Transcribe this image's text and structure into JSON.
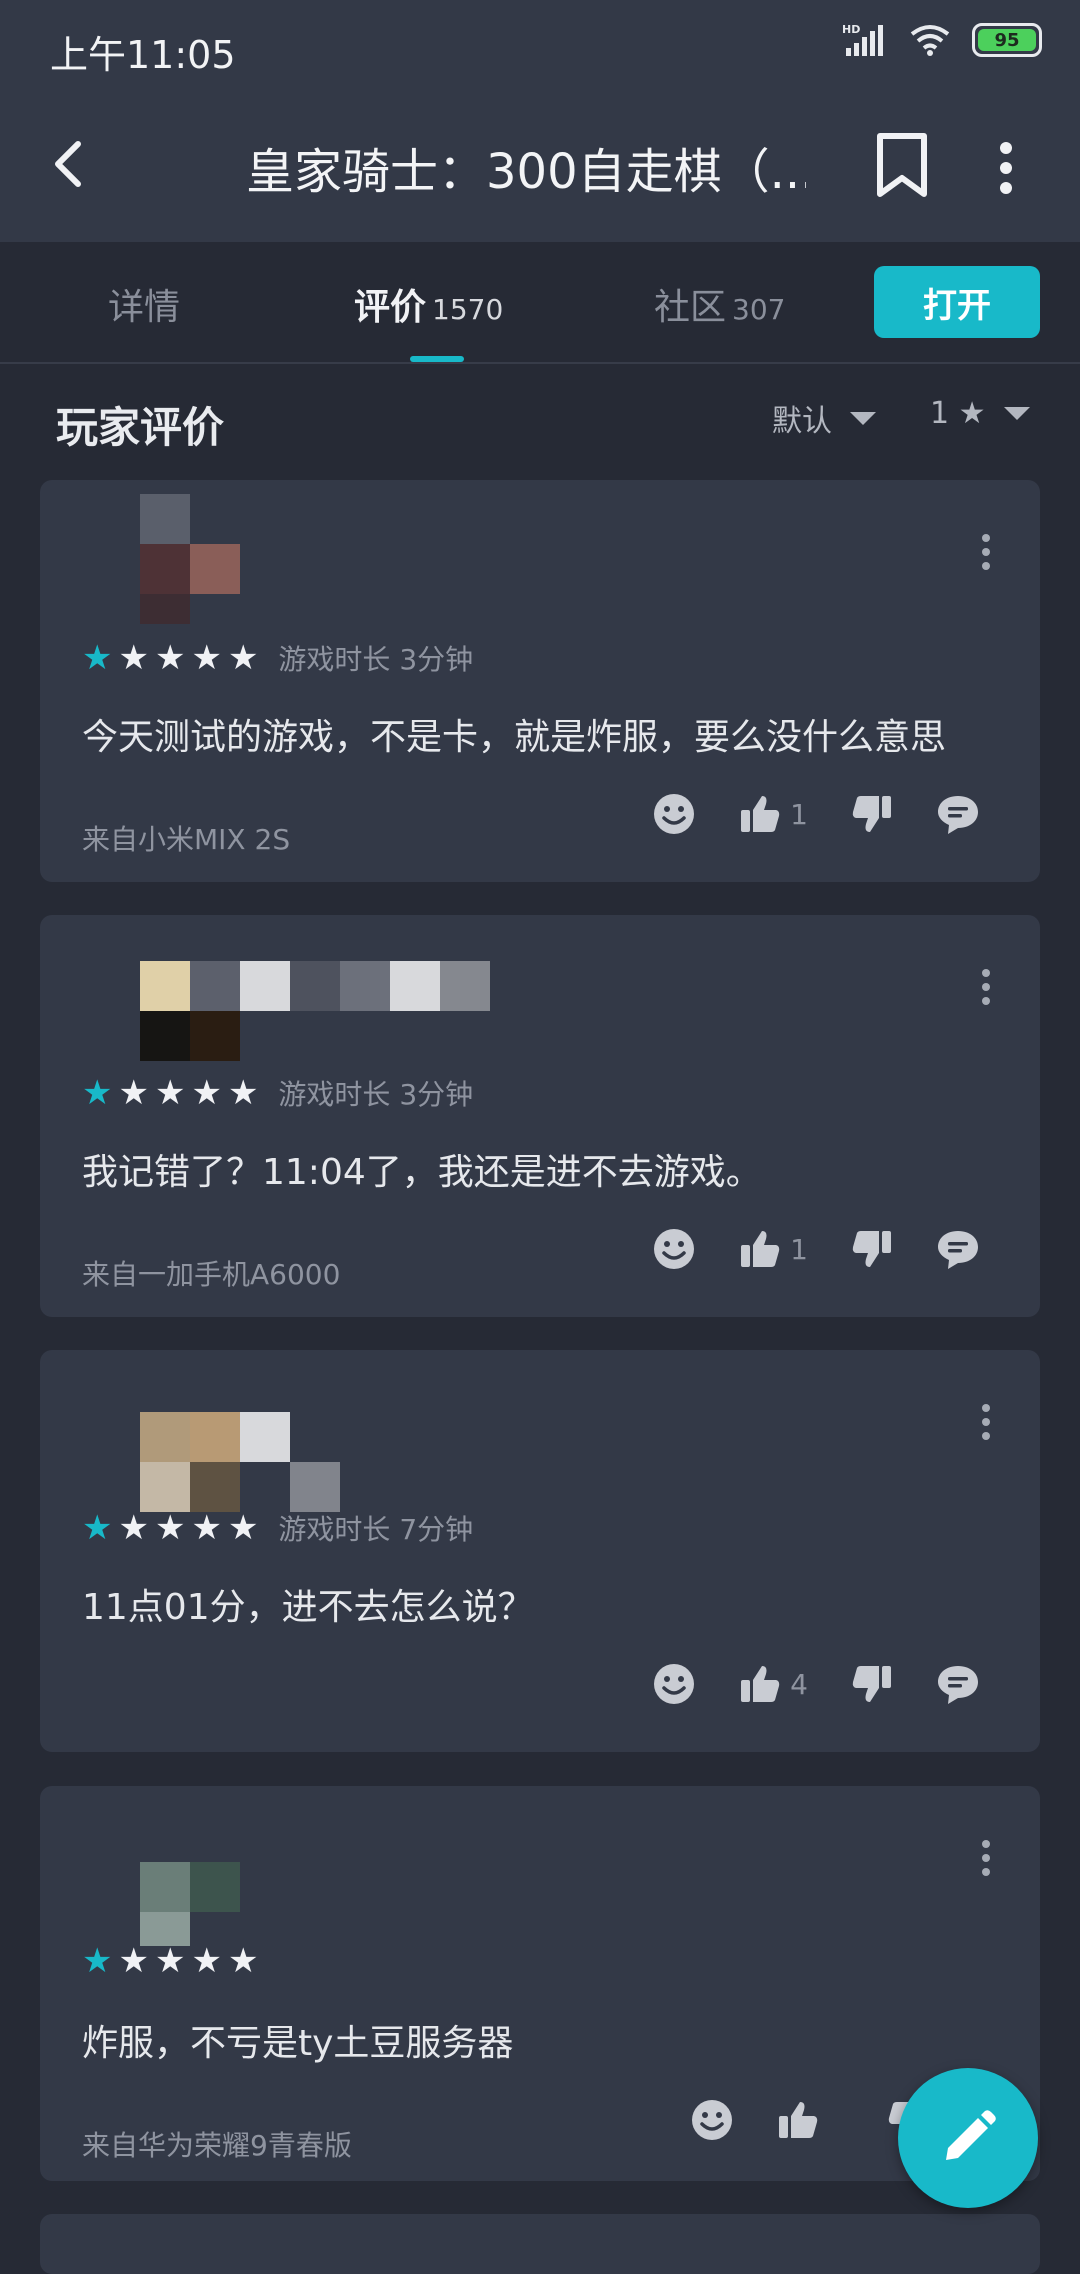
{
  "status_bar": {
    "time": "上午11:05",
    "battery": "95",
    "icons": [
      "hd-signal-icon",
      "wifi-icon",
      "battery-icon"
    ]
  },
  "app_bar": {
    "title": "皇家骑士：300自走棋（...",
    "icons": [
      "back-icon",
      "bookmark-icon",
      "more-vertical-icon"
    ]
  },
  "tabs": [
    {
      "label": "详情",
      "count": ""
    },
    {
      "label": "评价",
      "count": "1570"
    },
    {
      "label": "社区",
      "count": "307"
    }
  ],
  "active_tab": "评价",
  "open_button": "打开",
  "section": {
    "title": "玩家评价",
    "sort_label": "默认",
    "filter_label": "1 ★"
  },
  "reviews": [
    {
      "stars": 1,
      "playtime": "游戏时长 3分钟",
      "text": "今天测试的游戏，不是卡，就是炸服，要么没什么意思",
      "device": "来自小米MIX 2S",
      "likes": "1"
    },
    {
      "stars": 1,
      "playtime": "游戏时长 3分钟",
      "text": "我记错了？11:04了，我还是进不去游戏。",
      "device": "来自一加手机A6000",
      "likes": "1"
    },
    {
      "stars": 1,
      "playtime": "游戏时长 7分钟",
      "text": "11点01分，进不去怎么说？",
      "device": "",
      "likes": "4"
    },
    {
      "stars": 1,
      "playtime": "",
      "text": "炸服，不亏是ty土豆服务器",
      "device": "来自华为荣耀9青春版",
      "likes": ""
    }
  ],
  "colors": {
    "accent": "#18b9c9",
    "background": "#262a35",
    "card": "#333947",
    "header": "#333947"
  }
}
